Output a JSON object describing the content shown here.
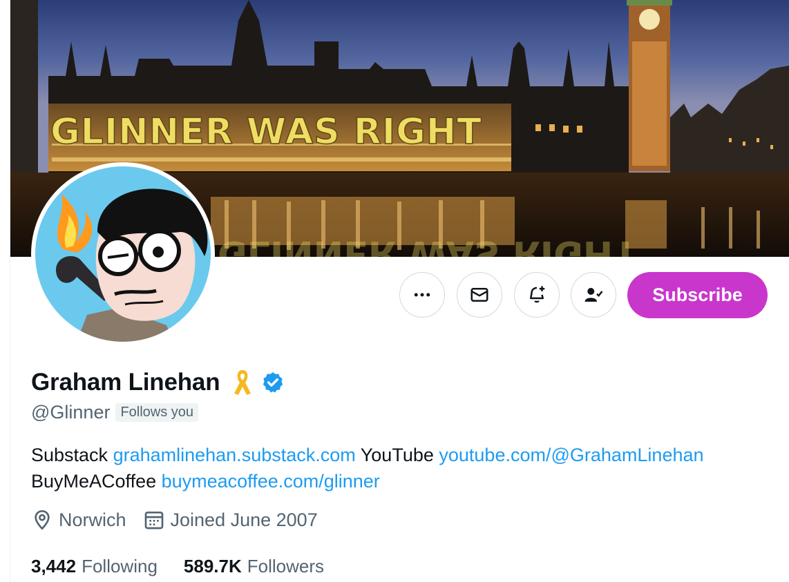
{
  "banner": {
    "projection_text": "GLINNER WAS RIGHT",
    "reflection_text": "GLINNER WAS RIGHT"
  },
  "actions": {
    "more_icon": "more-horizontal-icon",
    "message_icon": "mail-icon",
    "notify_icon": "bell-plus-icon",
    "following_icon": "person-check-icon",
    "subscribe_label": "Subscribe",
    "subscribe_color": "#c936cc"
  },
  "profile": {
    "name": "Graham Linehan",
    "handle": "@Glinner",
    "follows_you": "Follows you",
    "name_icons": [
      "awareness-ribbon-icon",
      "verified-badge-icon"
    ],
    "bio": {
      "seg1": "Substack ",
      "link1": "grahamlinehan.substack.com",
      "seg2": " YouTube ",
      "link2": "youtube.com/@GrahamLinehan",
      "seg3": "BuyMeACoffee ",
      "link3": "buymeacoffee.com/glinner"
    },
    "location": "Norwich",
    "joined": "Joined June 2007",
    "following_count": "3,442",
    "following_label": "Following",
    "followers_count": "589.7K",
    "followers_label": "Followers"
  },
  "colors": {
    "link": "#1d9bf0",
    "secondary_text": "#536471",
    "verified": "#1d9bf0",
    "ribbon": "#f5b820"
  }
}
